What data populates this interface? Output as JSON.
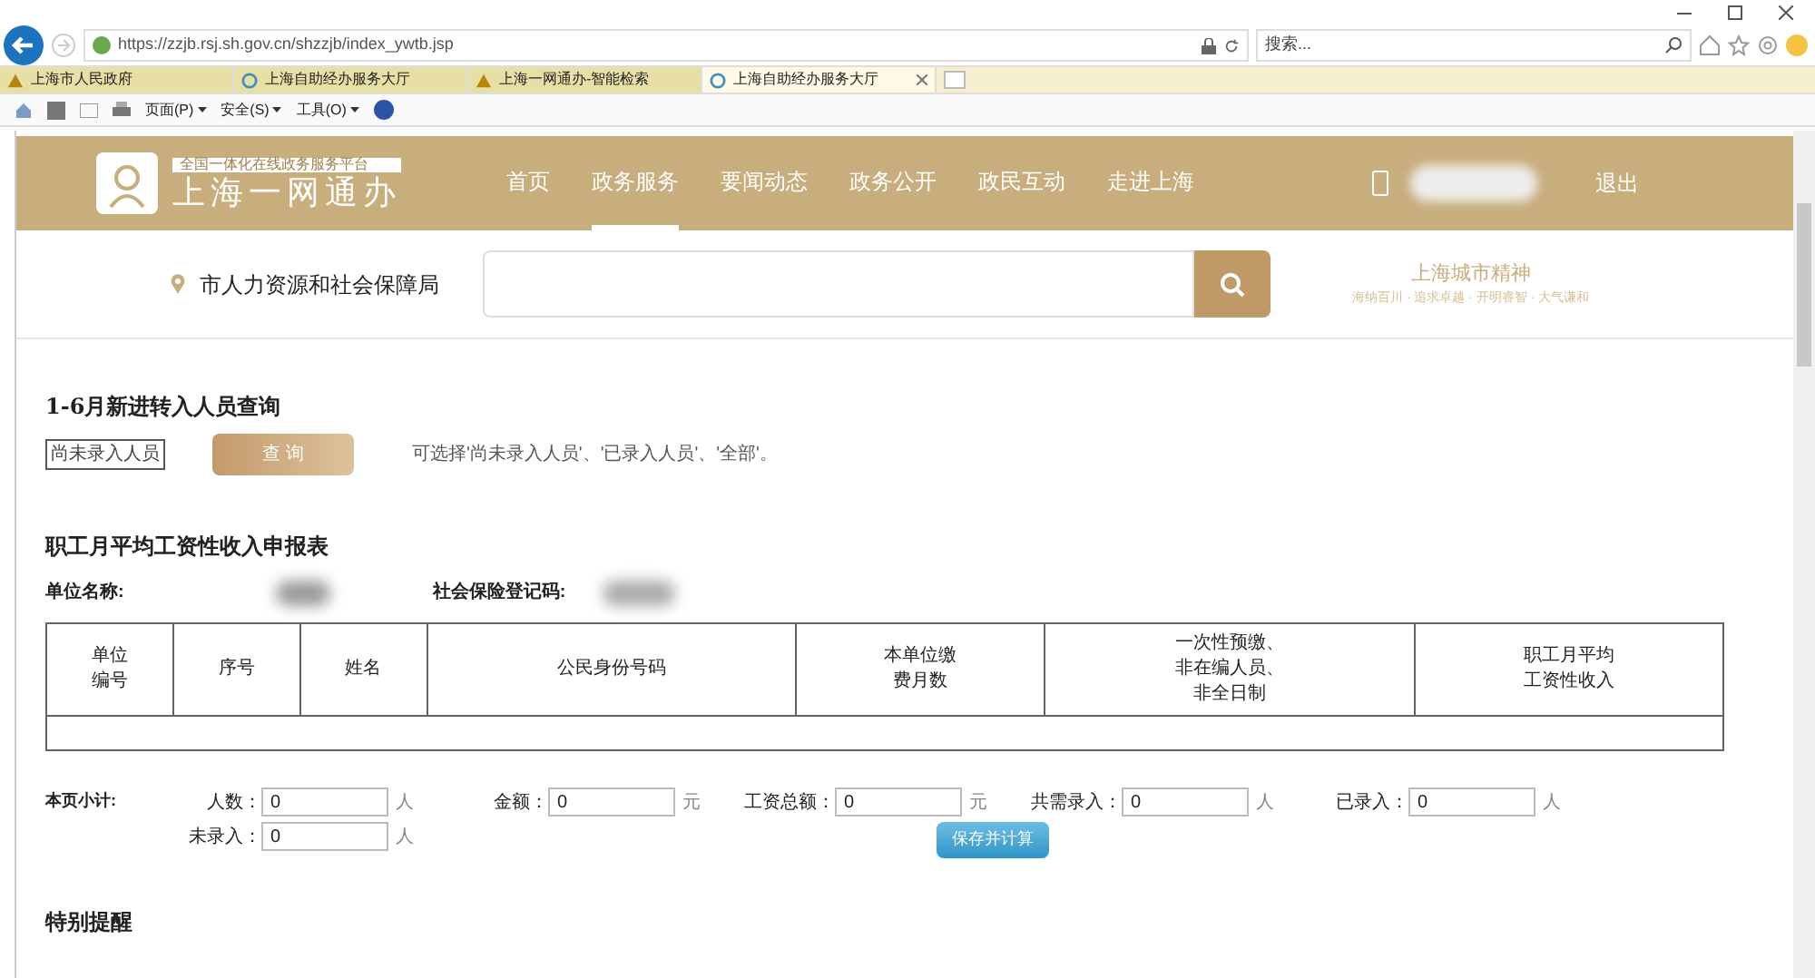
{
  "browser": {
    "url": "https://zzjb.rsj.sh.gov.cn/shzzjb/index_ywtb.jsp",
    "search_placeholder": "搜索...",
    "tabs": [
      {
        "label": "上海市人民政府",
        "kind": "warning",
        "selected": false
      },
      {
        "label": "上海自助经办服务大厅",
        "kind": "ie",
        "selected": false
      },
      {
        "label": "上海一网通办-智能检索",
        "kind": "warning",
        "selected": false
      },
      {
        "label": "上海自助经办服务大厅",
        "kind": "ie",
        "selected": true
      }
    ],
    "commands": [
      "页面(P)",
      "安全(S)",
      "工具(O)"
    ]
  },
  "site": {
    "tagline": "全国一体化在线政务服务平台",
    "name": "上海一网通办",
    "nav": [
      {
        "label": "首页",
        "selected": false
      },
      {
        "label": "政务服务",
        "selected": true
      },
      {
        "label": "要闻动态",
        "selected": false
      },
      {
        "label": "政务公开",
        "selected": false
      },
      {
        "label": "政民互动",
        "selected": false
      },
      {
        "label": "走进上海",
        "selected": false
      }
    ],
    "logout": "退出",
    "location": "市人力资源和社会保障局",
    "slogan_title": "上海城市精神",
    "slogan_sub": "海纳百川 · 追求卓越 · 开明睿智 · 大气谦和"
  },
  "query": {
    "title": "1-6月新进转入人员查询",
    "select_value": "尚未录入人员",
    "button": "查 询",
    "hint": "可选择'尚未录入人员'、'已录入人员'、'全部'。"
  },
  "form": {
    "title": "职工月平均工资性收入申报表",
    "unit_label": "单位名称:",
    "reg_label": "社会保险登记码:",
    "columns": [
      [
        "单位",
        "编号"
      ],
      [
        "序号"
      ],
      [
        "姓名"
      ],
      [
        "公民身份号码"
      ],
      [
        "本单位缴",
        "费月数"
      ],
      [
        "一次性预缴、",
        "非在编人员、",
        "非全日制"
      ],
      [
        "职工月平均",
        "工资性收入"
      ]
    ],
    "subtotal_label": "本页小计:",
    "fields": [
      {
        "label": "人数：",
        "value": "0",
        "unit": "人"
      },
      {
        "label": "金额：",
        "value": "0",
        "unit": "元"
      },
      {
        "label": "工资总额：",
        "value": "0",
        "unit": "元"
      },
      {
        "label": "共需录入：",
        "value": "0",
        "unit": "人"
      },
      {
        "label": "已录入：",
        "value": "0",
        "unit": "人"
      }
    ],
    "second_fields": [
      {
        "label": "未录入：",
        "value": "0",
        "unit": "人"
      }
    ],
    "save_button": "保存并计算",
    "reminder": "特别提醒"
  }
}
